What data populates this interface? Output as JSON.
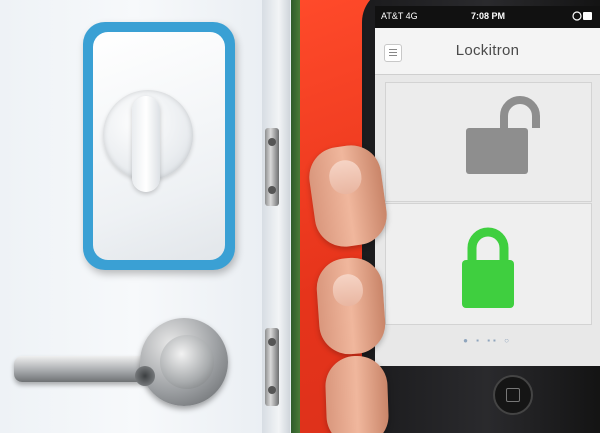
{
  "scene": {
    "left_panel": {
      "subject": "smart-lock-on-door",
      "device_color": "#3aa0d4",
      "background_color": "#eef2f6"
    },
    "right_panel": {
      "subject": "hand-holding-phone",
      "background_color": "#e6341b"
    }
  },
  "phone": {
    "status_bar": {
      "carrier": "AT&T 4G",
      "time": "7:08 PM"
    },
    "app": {
      "title": "Lockitron",
      "menu_icon": "hamburger-menu-icon",
      "unlocked_icon": "padlock-open-icon",
      "unlocked_color": "#8e8e8e",
      "locked_icon": "padlock-closed-icon",
      "locked_color": "#3fcf3f",
      "pager": "● ▪ ▪▪ ○"
    }
  }
}
